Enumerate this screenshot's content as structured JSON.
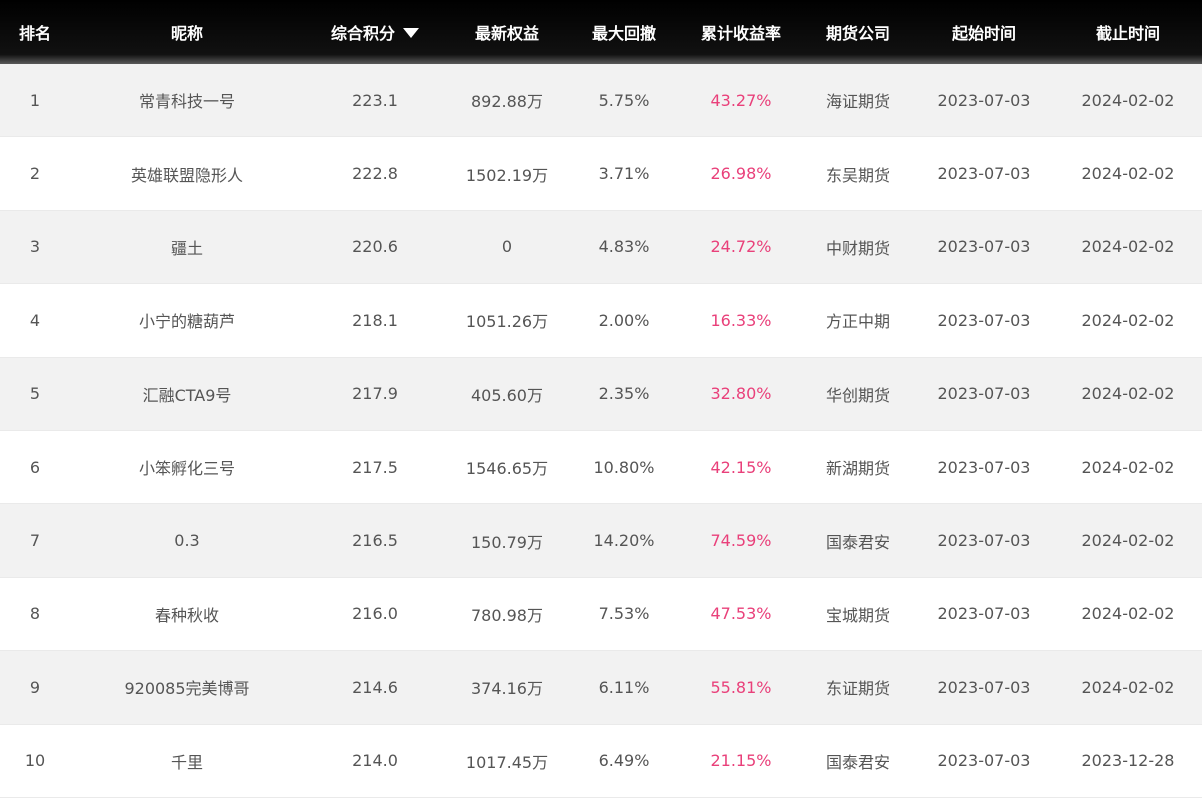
{
  "headers": [
    "排名",
    "昵称",
    "综合积分",
    "最新权益",
    "最大回撤",
    "累计收益率",
    "期货公司",
    "起始时间",
    "截止时间"
  ],
  "colors": {
    "header_bg": "#000000",
    "odd_row_bg": "#f2f2f2",
    "accent_pink": "#e9407a"
  },
  "sort_icon": "triangle-down-icon",
  "rows": [
    {
      "rank": "1",
      "name": "常青科技一号",
      "score": "223.1",
      "equity": "892.88万",
      "drawdown": "5.75%",
      "return": "43.27%",
      "company": "海证期货",
      "start": "2023-07-03",
      "end": "2024-02-02"
    },
    {
      "rank": "2",
      "name": "英雄联盟隐形人",
      "score": "222.8",
      "equity": "1502.19万",
      "drawdown": "3.71%",
      "return": "26.98%",
      "company": "东吴期货",
      "start": "2023-07-03",
      "end": "2024-02-02"
    },
    {
      "rank": "3",
      "name": "疆土",
      "score": "220.6",
      "equity": "0",
      "drawdown": "4.83%",
      "return": "24.72%",
      "company": "中财期货",
      "start": "2023-07-03",
      "end": "2024-02-02"
    },
    {
      "rank": "4",
      "name": "小宁的糖葫芦",
      "score": "218.1",
      "equity": "1051.26万",
      "drawdown": "2.00%",
      "return": "16.33%",
      "company": "方正中期",
      "start": "2023-07-03",
      "end": "2024-02-02"
    },
    {
      "rank": "5",
      "name": "汇融CTA9号",
      "score": "217.9",
      "equity": "405.60万",
      "drawdown": "2.35%",
      "return": "32.80%",
      "company": "华创期货",
      "start": "2023-07-03",
      "end": "2024-02-02"
    },
    {
      "rank": "6",
      "name": "小笨孵化三号",
      "score": "217.5",
      "equity": "1546.65万",
      "drawdown": "10.80%",
      "return": "42.15%",
      "company": "新湖期货",
      "start": "2023-07-03",
      "end": "2024-02-02"
    },
    {
      "rank": "7",
      "name": "0.3",
      "score": "216.5",
      "equity": "150.79万",
      "drawdown": "14.20%",
      "return": "74.59%",
      "company": "国泰君安",
      "start": "2023-07-03",
      "end": "2024-02-02"
    },
    {
      "rank": "8",
      "name": "春种秋收",
      "score": "216.0",
      "equity": "780.98万",
      "drawdown": "7.53%",
      "return": "47.53%",
      "company": "宝城期货",
      "start": "2023-07-03",
      "end": "2024-02-02"
    },
    {
      "rank": "9",
      "name": "920085完美博哥",
      "score": "214.6",
      "equity": "374.16万",
      "drawdown": "6.11%",
      "return": "55.81%",
      "company": "东证期货",
      "start": "2023-07-03",
      "end": "2024-02-02"
    },
    {
      "rank": "10",
      "name": "千里",
      "score": "214.0",
      "equity": "1017.45万",
      "drawdown": "6.49%",
      "return": "21.15%",
      "company": "国泰君安",
      "start": "2023-07-03",
      "end": "2023-12-28"
    }
  ]
}
